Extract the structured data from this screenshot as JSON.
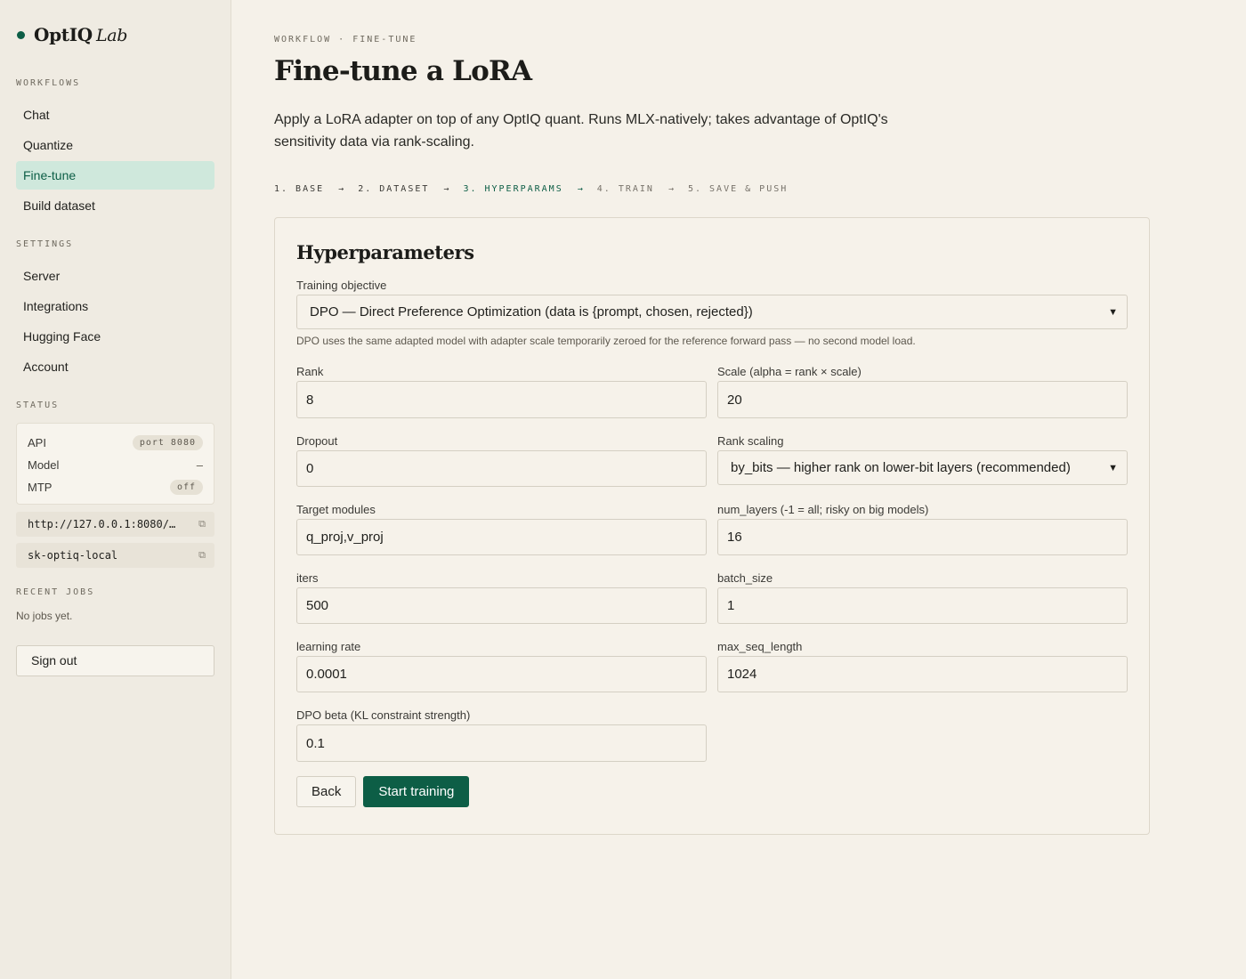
{
  "brand": {
    "name": "OptIQ",
    "suffix": "Lab",
    "accent": "#0d5e46"
  },
  "sidebar": {
    "workflows_label": "WORKFLOWS",
    "workflows": [
      {
        "label": "Chat",
        "active": false
      },
      {
        "label": "Quantize",
        "active": false
      },
      {
        "label": "Fine-tune",
        "active": true
      },
      {
        "label": "Build dataset",
        "active": false
      }
    ],
    "settings_label": "SETTINGS",
    "settings": [
      {
        "label": "Server"
      },
      {
        "label": "Integrations"
      },
      {
        "label": "Hugging Face"
      },
      {
        "label": "Account"
      }
    ],
    "status_label": "STATUS",
    "status": {
      "api_label": "API",
      "api_value": "port 8080",
      "model_label": "Model",
      "model_value": "–",
      "mtp_label": "MTP",
      "mtp_value": "off"
    },
    "endpoint": "http://127.0.0.1:8080/…",
    "api_key": "sk-optiq-local",
    "copy_icon": "copy-icon",
    "recent_label": "RECENT JOBS",
    "recent_empty": "No jobs yet.",
    "sign_out": "Sign out"
  },
  "main": {
    "breadcrumb": "WORKFLOW · FINE-TUNE",
    "title": "Fine-tune a LoRA",
    "intro": "Apply a LoRA adapter on top of any OptIQ quant. Runs MLX-natively; takes advantage of OptIQ's sensitivity data via rank-scaling.",
    "steps": [
      {
        "label": "1. BASE",
        "state": "done"
      },
      {
        "label": "2. DATASET",
        "state": "done"
      },
      {
        "label": "3. HYPERPARAMS",
        "state": "current"
      },
      {
        "label": "4. TRAIN",
        "state": "future"
      },
      {
        "label": "5. SAVE & PUSH",
        "state": "future"
      }
    ],
    "arrow": "→"
  },
  "form": {
    "title": "Hyperparameters",
    "objective": {
      "label": "Training objective",
      "value": "DPO — Direct Preference Optimization (data is {prompt, chosen, rejected})",
      "hint": "DPO uses the same adapted model with adapter scale temporarily zeroed for the reference forward pass — no second model load."
    },
    "rank": {
      "label": "Rank",
      "value": "8"
    },
    "scale": {
      "label": "Scale (alpha = rank × scale)",
      "value": "20"
    },
    "dropout": {
      "label": "Dropout",
      "value": "0"
    },
    "rank_scaling": {
      "label": "Rank scaling",
      "value": "by_bits — higher rank on lower-bit layers (recommended)"
    },
    "target_modules": {
      "label": "Target modules",
      "value": "q_proj,v_proj"
    },
    "num_layers": {
      "label": "num_layers (-1 = all; risky on big models)",
      "value": "16"
    },
    "iters": {
      "label": "iters",
      "value": "500"
    },
    "batch_size": {
      "label": "batch_size",
      "value": "1"
    },
    "learning_rate": {
      "label": "learning rate",
      "value": "0.0001"
    },
    "max_seq_length": {
      "label": "max_seq_length",
      "value": "1024"
    },
    "dpo_beta": {
      "label": "DPO beta (KL constraint strength)",
      "value": "0.1"
    },
    "back": "Back",
    "start": "Start training"
  }
}
